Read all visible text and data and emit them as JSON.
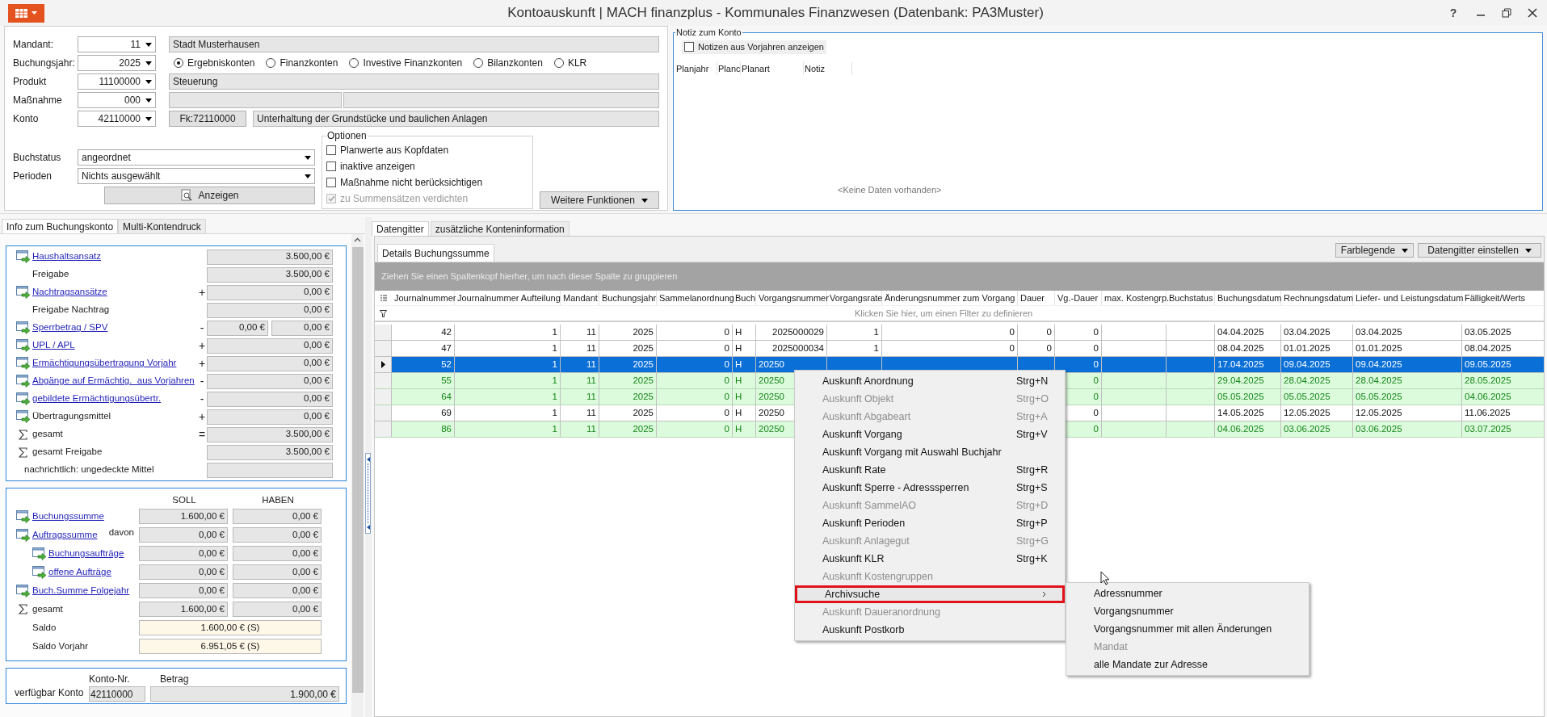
{
  "window": {
    "title": "Kontoauskunft | MACH finanzplus - Kommunales Finanzwesen (Datenbank: PA3Muster)",
    "help": "?"
  },
  "form": {
    "mandant": {
      "label": "Mandant:",
      "value": "11",
      "text": "Stadt Musterhausen"
    },
    "buchungsjahr": {
      "label": "Buchungsjahr:",
      "value": "2025"
    },
    "account_types": [
      {
        "label": "Ergebniskonten",
        "selected": true
      },
      {
        "label": "Finanzkonten",
        "selected": false
      },
      {
        "label": "Investive Finanzkonten",
        "selected": false
      },
      {
        "label": "Bilanzkonten",
        "selected": false
      },
      {
        "label": "KLR",
        "selected": false
      }
    ],
    "produkt": {
      "label": "Produkt",
      "value": "11100000",
      "text": "Steuerung"
    },
    "massnahme": {
      "label": "Maßnahme",
      "value": "000"
    },
    "konto": {
      "label": "Konto",
      "value": "42110000",
      "fk_button": "Fk:72110000",
      "text": "Unterhaltung der Grundstücke und baulichen Anlagen"
    },
    "buchstatus": {
      "label": "Buchstatus",
      "value": "angeordnet"
    },
    "perioden": {
      "label": "Perioden",
      "value": "Nichts ausgewählt"
    },
    "show_button": "Anzeigen",
    "options": {
      "title": "Optionen",
      "items": [
        {
          "label": "Planwerte aus Kopfdaten",
          "checked": false,
          "disabled": false
        },
        {
          "label": "inaktive anzeigen",
          "checked": false,
          "disabled": false
        },
        {
          "label": "Maßnahme nicht berücksichtigen",
          "checked": false,
          "disabled": false
        },
        {
          "label": "zu Summensätzen verdichten",
          "checked": true,
          "disabled": true
        }
      ]
    },
    "more_button": "Weitere Funktionen"
  },
  "notes": {
    "title": "Notiz zum Konto",
    "show_previous": {
      "label": "Notizen aus Vorjahren anzeigen",
      "checked": false
    },
    "columns": [
      "Planjahr",
      "Planc",
      "Planart",
      "Notiz"
    ],
    "empty_text": "<Keine Daten vorhanden>"
  },
  "info_tabs": [
    {
      "label": "Info zum Buchungskonto",
      "selected": true
    },
    {
      "label": "Multi-Kontendruck",
      "selected": false
    }
  ],
  "budget": {
    "rows": [
      {
        "kind": "link",
        "label": "Haushaltsansatz",
        "values": [
          "3.500,00 €"
        ]
      },
      {
        "kind": "plain",
        "label": "Freigabe",
        "values": [
          "3.500,00 €"
        ]
      },
      {
        "kind": "link",
        "label": "Nachtragsansätze",
        "sign": "+",
        "values": [
          "0,00 €"
        ]
      },
      {
        "kind": "plain",
        "label": "Freigabe Nachtrag",
        "values": [
          "0,00 €"
        ]
      },
      {
        "kind": "link",
        "label": "Sperrbetrag / SPV",
        "sign": "-",
        "values": [
          "0,00 €",
          "0,00 €"
        ]
      },
      {
        "kind": "link",
        "label": "UPL / APL",
        "sign": "+",
        "values": [
          "0,00 €"
        ]
      },
      {
        "kind": "link",
        "label": "Ermächtigungsübertragung Vorjahr",
        "sign": "+",
        "values": [
          "0,00 €"
        ]
      },
      {
        "kind": "link",
        "label": "Abgänge auf Ermächtig.  aus Vorjahren",
        "sign": "-",
        "values": [
          "0,00 €"
        ]
      },
      {
        "kind": "link",
        "label": "gebildete Ermächtigungsübertr.",
        "sign": "-",
        "values": [
          "0,00 €"
        ]
      },
      {
        "kind": "icon",
        "label": "Übertragungsmittel",
        "sign": "+",
        "values": [
          "0,00 €"
        ]
      },
      {
        "kind": "sum",
        "label": "gesamt",
        "sign": "=",
        "values": [
          "3.500,00 €"
        ]
      },
      {
        "kind": "sum",
        "label": "gesamt Freigabe",
        "values": [
          "3.500,00 €"
        ]
      },
      {
        "kind": "note",
        "label": "nachrichtlich: ungedeckte Mittel",
        "values": []
      }
    ]
  },
  "bookings": {
    "columns": [
      "SOLL",
      "HABEN"
    ],
    "rows": [
      {
        "kind": "link",
        "label": "Buchungssumme",
        "values": [
          "1.600,00 €",
          "0,00 €"
        ]
      },
      {
        "kind": "link",
        "label": "Auftragssumme",
        "note": "davon",
        "values": [
          "0,00 €",
          "0,00 €"
        ]
      },
      {
        "kind": "sublink",
        "label": "Buchungsaufträge",
        "values": [
          "0,00 €",
          "0,00 €"
        ]
      },
      {
        "kind": "sublink",
        "label": "offene Aufträge",
        "values": [
          "0,00 €",
          "0,00 €"
        ]
      },
      {
        "kind": "link",
        "label": "Buch.Summe Folgejahr",
        "values": [
          "0,00 €",
          "0,00 €"
        ]
      },
      {
        "kind": "sum",
        "label": "gesamt",
        "values": [
          "1.600,00 €",
          "0,00 €"
        ]
      },
      {
        "kind": "saldo",
        "label": "Saldo",
        "values": [
          "1.600,00 € (S)"
        ]
      },
      {
        "kind": "saldo",
        "label": "Saldo Vorjahr",
        "values": [
          "6.951,05 € (S)"
        ]
      }
    ]
  },
  "available": {
    "label": "verfügbar Konto",
    "columns": [
      "Konto-Nr.",
      "Betrag"
    ],
    "konto": "42110000",
    "betrag": "1.900,00 €"
  },
  "grid_tabs": [
    {
      "label": "Datengitter",
      "selected": true
    },
    {
      "label": "zusätzliche Konteninformation",
      "selected": false
    }
  ],
  "detail_tabs": [
    {
      "label": "Details Buchungssumme",
      "selected": true
    }
  ],
  "grid_toolbar": [
    "Farblegende",
    "Datengitter einstellen"
  ],
  "group_hint": "Ziehen Sie einen Spaltenkopf hierher, um nach dieser Spalte zu gruppieren",
  "filter_hint": "Klicken Sie hier, um einen Filter zu definieren",
  "table": {
    "columns": [
      "Journalnummer",
      "Journalnummer Aufteilung",
      "Mandant",
      "Buchungsjahr",
      "Sammelanordnung",
      "Buch",
      "Vorgangsnummer",
      "Vorgangsrate",
      "Änderungsnummer zum Vorgang",
      "Dauer",
      "Vg.-Dauer",
      "max. Kostengrp.",
      "Buchstatus",
      "Buchungsdatum",
      "Rechnungsdatum",
      "Liefer- und Leistungsdatum",
      "Fälligkeit/Werts"
    ],
    "rows": [
      {
        "kind": "plain",
        "selected": false,
        "covered": false,
        "cells": [
          "42",
          "1",
          "11",
          "2025",
          "0",
          "H",
          "2025000029",
          "1",
          "0",
          "0",
          "0",
          null,
          null,
          "04.04.2025",
          "03.04.2025",
          "03.04.2025",
          "03.05.2025"
        ]
      },
      {
        "kind": "plain",
        "selected": false,
        "covered": false,
        "cells": [
          "47",
          "1",
          "11",
          "2025",
          "0",
          "H",
          "2025000034",
          "1",
          "0",
          "0",
          "0",
          null,
          null,
          "08.04.2025",
          "01.01.2025",
          "01.01.2025",
          "08.04.2025"
        ]
      },
      {
        "kind": "plain",
        "selected": true,
        "covered": true,
        "cells": [
          "52",
          "1",
          "11",
          "2025",
          "0",
          "H",
          "20250",
          null,
          null,
          null,
          "0",
          null,
          null,
          "17.04.2025",
          "09.04.2025",
          "09.04.2025",
          "09.05.2025"
        ]
      },
      {
        "kind": "green",
        "selected": false,
        "covered": true,
        "cells": [
          "55",
          "1",
          "11",
          "2025",
          "0",
          "H",
          "20250",
          null,
          null,
          null,
          "0",
          null,
          null,
          "29.04.2025",
          "28.04.2025",
          "28.04.2025",
          "28.05.2025"
        ]
      },
      {
        "kind": "green",
        "selected": false,
        "covered": true,
        "cells": [
          "64",
          "1",
          "11",
          "2025",
          "0",
          "H",
          "20250",
          null,
          null,
          null,
          "0",
          null,
          null,
          "05.05.2025",
          "05.05.2025",
          "05.05.2025",
          "04.06.2025"
        ]
      },
      {
        "kind": "plain",
        "selected": false,
        "covered": true,
        "cells": [
          "69",
          "1",
          "11",
          "2025",
          "0",
          "H",
          "20250",
          null,
          null,
          null,
          "0",
          null,
          null,
          "14.05.2025",
          "12.05.2025",
          "12.05.2025",
          "11.06.2025"
        ]
      },
      {
        "kind": "green",
        "selected": false,
        "covered": true,
        "cells": [
          "86",
          "1",
          "11",
          "2025",
          "0",
          "H",
          "20250",
          null,
          null,
          null,
          "0",
          null,
          null,
          "04.06.2025",
          "03.06.2025",
          "03.06.2025",
          "03.07.2025"
        ]
      }
    ]
  },
  "context_menu": {
    "items": [
      {
        "label": "Auskunft Anordnung",
        "shortcut": "Strg+N",
        "disabled": false,
        "submenu": false,
        "selected": false
      },
      {
        "label": "Auskunft Objekt",
        "shortcut": "Strg+O",
        "disabled": true,
        "submenu": false,
        "selected": false
      },
      {
        "label": "Auskunft Abgabeart",
        "shortcut": "Strg+A",
        "disabled": true,
        "submenu": false,
        "selected": false
      },
      {
        "label": "Auskunft Vorgang",
        "shortcut": "Strg+V",
        "disabled": false,
        "submenu": false,
        "selected": false
      },
      {
        "label": "Auskunft Vorgang mit Auswahl Buchjahr",
        "disabled": false,
        "submenu": false,
        "selected": false
      },
      {
        "label": "Auskunft Rate",
        "shortcut": "Strg+R",
        "disabled": false,
        "submenu": false,
        "selected": false
      },
      {
        "label": "Auskunft Sperre - Adresssperren",
        "shortcut": "Strg+S",
        "disabled": false,
        "submenu": false,
        "selected": false
      },
      {
        "label": "Auskunft SammelAO",
        "shortcut": "Strg+D",
        "disabled": true,
        "submenu": false,
        "selected": false
      },
      {
        "label": "Auskunft Perioden",
        "shortcut": "Strg+P",
        "disabled": false,
        "submenu": false,
        "selected": false
      },
      {
        "label": "Auskunft Anlagegut",
        "shortcut": "Strg+G",
        "disabled": true,
        "submenu": false,
        "selected": false
      },
      {
        "label": "Auskunft KLR",
        "shortcut": "Strg+K",
        "disabled": false,
        "submenu": false,
        "selected": false
      },
      {
        "label": "Auskunft Kostengruppen",
        "disabled": true,
        "submenu": false,
        "selected": false
      },
      {
        "label": "Archivsuche",
        "disabled": false,
        "submenu": true,
        "selected": true
      },
      {
        "label": "Auskunft Daueranordnung",
        "disabled": true,
        "submenu": false,
        "selected": false
      },
      {
        "label": "Auskunft Postkorb",
        "disabled": false,
        "submenu": false,
        "selected": false
      }
    ]
  },
  "submenu": {
    "items": [
      {
        "label": "Adressnummer",
        "disabled": false
      },
      {
        "label": "Vorgangsnummer",
        "disabled": false
      },
      {
        "label": "Vorgangsnummer mit allen Änderungen",
        "disabled": false
      },
      {
        "label": "Mandat",
        "disabled": true
      },
      {
        "label": "alle Mandate zur Adresse",
        "disabled": false
      }
    ]
  }
}
